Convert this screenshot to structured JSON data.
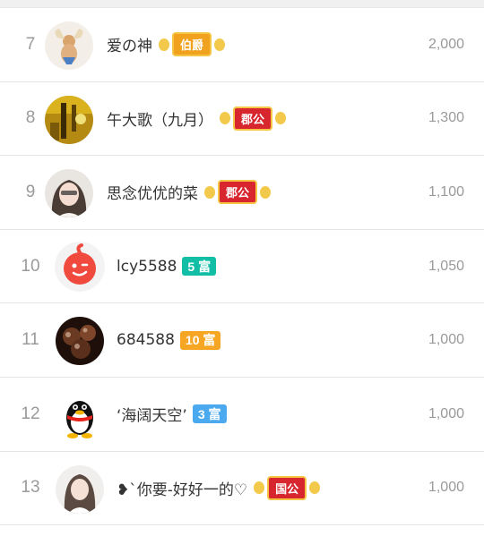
{
  "colors": {
    "wealth_teal": "#12bfa6",
    "wealth_orange": "#f6a623",
    "wealth_blue": "#4aa9ef"
  },
  "rows": [
    {
      "rank": "7",
      "name": "爱の神",
      "badge_text": "伯爵",
      "score": "2,000"
    },
    {
      "rank": "8",
      "name": "午大歌（九月）",
      "badge_text": "郡公",
      "score": "1,300"
    },
    {
      "rank": "9",
      "name": "思念优优的菜",
      "badge_text": "郡公",
      "score": "1,100"
    },
    {
      "rank": "10",
      "name": "lcy5588",
      "badge_text": "5 富",
      "score": "1,050"
    },
    {
      "rank": "11",
      "name": "684588",
      "badge_text": "10 富",
      "score": "1,000"
    },
    {
      "rank": "12",
      "name": "‘海阔天空’",
      "badge_text": "3 富",
      "score": "1,000"
    },
    {
      "rank": "13",
      "name": "❥`你要-好好一的♡",
      "badge_text": "国公",
      "score": "1,000"
    }
  ]
}
